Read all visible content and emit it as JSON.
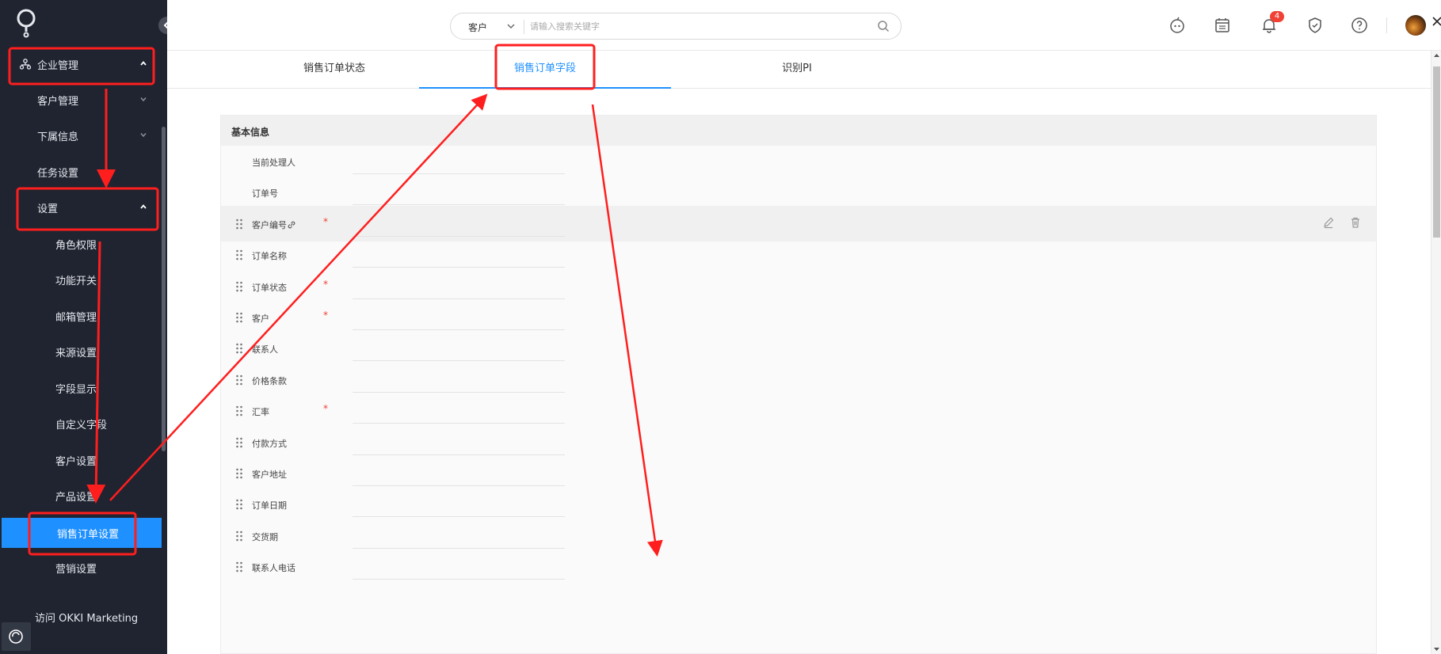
{
  "colors": {
    "sidebar_bg": "#1f2430",
    "accent": "#1e90ff",
    "annotation": "#ff1e1e",
    "required": "#f04134"
  },
  "sidebar": {
    "logo": "logo-icon",
    "items": [
      {
        "label": "企业管理",
        "icon": "org-icon",
        "expanded": true
      },
      {
        "label": "客户管理",
        "expanded": false
      },
      {
        "label": "下属信息",
        "expanded": false
      },
      {
        "label": "任务设置"
      },
      {
        "label": "设置",
        "expanded": true
      },
      {
        "label": "角色权限"
      },
      {
        "label": "功能开关"
      },
      {
        "label": "邮箱管理"
      },
      {
        "label": "来源设置"
      },
      {
        "label": "字段显示"
      },
      {
        "label": "自定义字段"
      },
      {
        "label": "客户设置"
      },
      {
        "label": "产品设置"
      },
      {
        "label": "销售订单设置",
        "active": true
      },
      {
        "label": "营销设置"
      }
    ],
    "footer_link": "访问 OKKI Marketing"
  },
  "header": {
    "search": {
      "scope": "客户",
      "placeholder": "请输入搜索关键字",
      "value": ""
    },
    "notification_count": "4",
    "icons": [
      "robot-icon",
      "calendar-icon",
      "bell-icon",
      "shield-check-icon",
      "help-icon",
      "avatar"
    ]
  },
  "tabs": [
    {
      "label": "销售订单状态",
      "active": false
    },
    {
      "label": "销售订单字段",
      "active": true
    },
    {
      "label": "识别PI",
      "active": false
    }
  ],
  "form": {
    "section_title": "基本信息",
    "fields": [
      {
        "label": "当前处理人",
        "required": false,
        "draggable": false
      },
      {
        "label": "订单号",
        "required": false,
        "draggable": false
      },
      {
        "label": "客户编号",
        "required": true,
        "draggable": true,
        "linked": true,
        "hovered": true
      },
      {
        "label": "订单名称",
        "required": false,
        "draggable": true
      },
      {
        "label": "订单状态",
        "required": true,
        "draggable": true
      },
      {
        "label": "客户",
        "required": true,
        "draggable": true
      },
      {
        "label": "联系人",
        "required": false,
        "draggable": true
      },
      {
        "label": "价格条款",
        "required": false,
        "draggable": true
      },
      {
        "label": "汇率",
        "required": true,
        "draggable": true
      },
      {
        "label": "付款方式",
        "required": false,
        "draggable": true
      },
      {
        "label": "客户地址",
        "required": false,
        "draggable": true
      },
      {
        "label": "订单日期",
        "required": false,
        "draggable": true
      },
      {
        "label": "交货期",
        "required": false,
        "draggable": true
      },
      {
        "label": "联系人电话",
        "required": false,
        "draggable": true
      }
    ],
    "required_mark": "*"
  }
}
